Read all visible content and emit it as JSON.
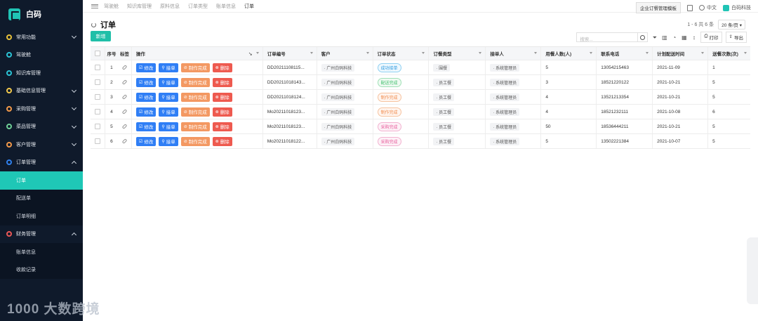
{
  "brand": {
    "name": "白码"
  },
  "sidebar": {
    "items": [
      {
        "label": "常用功能",
        "color": "#e7c13a",
        "icon": "gear-icon",
        "chevron": "down"
      },
      {
        "label": "驾驶舱",
        "color": "#2bc4d6",
        "icon": "dashboard-icon"
      },
      {
        "label": "知识库管理",
        "color": "#2bc4d6",
        "icon": "book-icon"
      },
      {
        "label": "基础信息管理",
        "color": "#f2c94c",
        "icon": "info-icon",
        "chevron": "down"
      },
      {
        "label": "采购管理",
        "color": "#f2994a",
        "icon": "cart-icon",
        "chevron": "down"
      },
      {
        "label": "菜品管理",
        "color": "#6fcf97",
        "icon": "dish-icon",
        "chevron": "down"
      },
      {
        "label": "客户管理",
        "color": "#f2994a",
        "icon": "user-icon",
        "chevron": "down"
      },
      {
        "label": "订单管理",
        "color": "#2f80ed",
        "icon": "order-icon",
        "chevron": "up"
      }
    ],
    "order_sub": [
      {
        "label": "订单",
        "active": true
      },
      {
        "label": "配送单"
      },
      {
        "label": "订单明细"
      }
    ],
    "finance": {
      "label": "财务管理",
      "color": "#eb5757",
      "icon": "finance-icon",
      "chevron": "up"
    },
    "finance_sub": [
      {
        "label": "账单信息"
      },
      {
        "label": "收款记录"
      }
    ],
    "watermark": "大数跨境"
  },
  "topbar": {
    "tabs": [
      "驾驶舱",
      "知识库管理",
      "原料信息",
      "订单类型",
      "账单信息",
      "订单"
    ],
    "template_btn": "企业订餐管理模板",
    "lang": "中文",
    "company": "白码科技"
  },
  "page": {
    "title": "订单",
    "pager_text": "1 - 6  共 6 条",
    "page_size": "20 条/页",
    "add_label": "新增",
    "search_placeholder": "搜索...",
    "print_label": "打印",
    "export_label": "导出"
  },
  "table": {
    "headers": {
      "idx": "序号",
      "tag": "标签",
      "ops": "操作",
      "no": "订单编号",
      "cust": "客户",
      "status": "订单状态",
      "type": "订餐类型",
      "taker": "接单人",
      "people": "用餐人数(人)",
      "phone": "联系电话",
      "date": "计划配送时间",
      "count": "送餐次数(次)"
    },
    "op_labels": {
      "edit": "修改",
      "take": "接单",
      "done": "制作完成",
      "del": "删除"
    },
    "rows": [
      {
        "idx": "1",
        "no": "DD20211108115...",
        "cust": "广州白码科技",
        "status": "成功接单",
        "status_color": "blue",
        "type": "围餐",
        "taker": "系统管理员",
        "people": "5",
        "phone": "13054215463",
        "date": "2021-11-09",
        "count": "1"
      },
      {
        "idx": "2",
        "no": "DD20211018143...",
        "cust": "广州白码科技",
        "status": "配送完成",
        "status_color": "green",
        "type": "员工餐",
        "taker": "系统管理员",
        "people": "3",
        "phone": "18521220122",
        "date": "2021-10-21",
        "count": "5"
      },
      {
        "idx": "3",
        "no": "DD20211018124...",
        "cust": "广州白码科技",
        "status": "制作完成",
        "status_color": "orange",
        "type": "员工餐",
        "taker": "系统管理员",
        "people": "4",
        "phone": "13521213354",
        "date": "2021-10-21",
        "count": "5"
      },
      {
        "idx": "4",
        "no": "Mo20211018123...",
        "cust": "广州白码科技",
        "status": "制作完成",
        "status_color": "orange",
        "type": "员工餐",
        "taker": "系统管理员",
        "people": "4",
        "phone": "18521232111",
        "date": "2021-10-08",
        "count": "6"
      },
      {
        "idx": "5",
        "no": "Mo20211018123...",
        "cust": "广州白码科技",
        "status": "采购完成",
        "status_color": "pink",
        "type": "员工餐",
        "taker": "系统管理员",
        "people": "50",
        "phone": "18536444211",
        "date": "2021-10-21",
        "count": "5"
      },
      {
        "idx": "6",
        "no": "Mo20211018122...",
        "cust": "广州白码科技",
        "status": "采购完成",
        "status_color": "pink",
        "type": "员工餐",
        "taker": "系统管理员",
        "people": "5",
        "phone": "13502221384",
        "date": "2021-10-07",
        "count": "5"
      }
    ]
  }
}
